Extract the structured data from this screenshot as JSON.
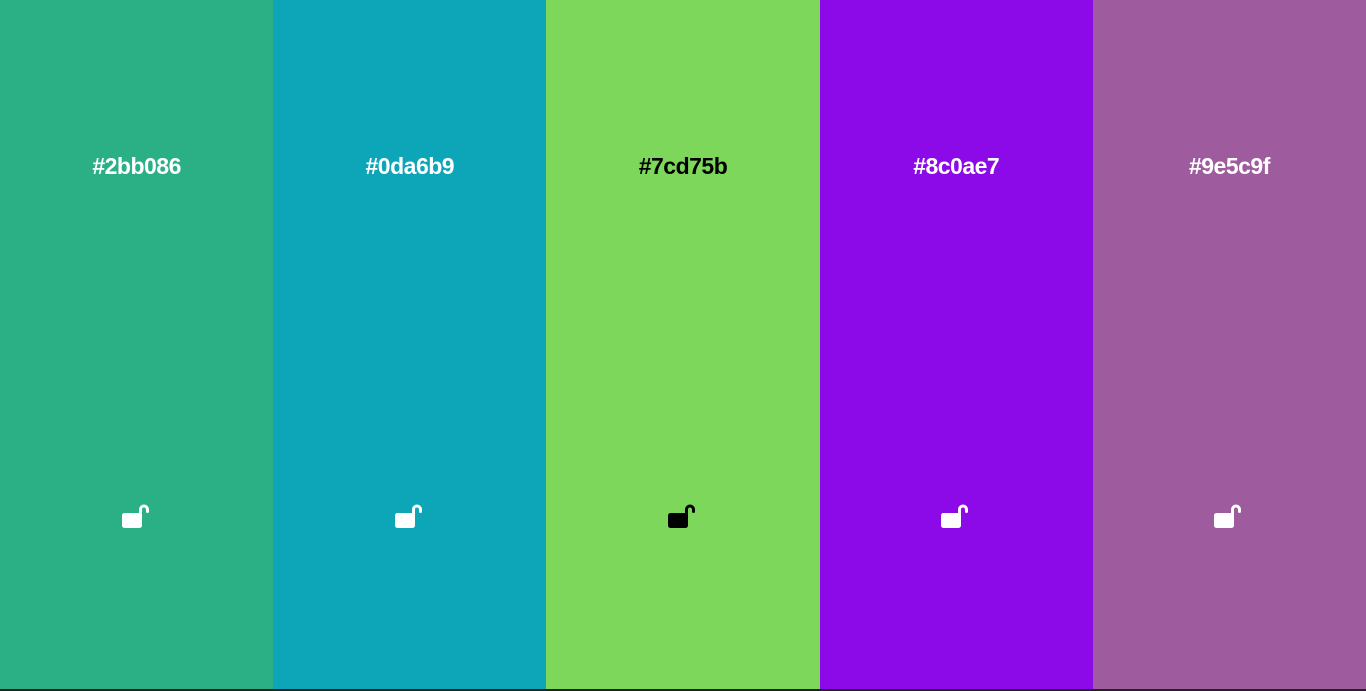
{
  "palette": {
    "colors": [
      {
        "hex": "#2bb086",
        "text_color": "#ffffff",
        "lock_state": "unlocked",
        "icon": "lock-open-icon"
      },
      {
        "hex": "#0da6b9",
        "text_color": "#ffffff",
        "lock_state": "unlocked",
        "icon": "lock-open-icon"
      },
      {
        "hex": "#7cd75b",
        "text_color": "#000000",
        "lock_state": "unlocked",
        "icon": "lock-open-icon"
      },
      {
        "hex": "#8c0ae7",
        "text_color": "#ffffff",
        "lock_state": "unlocked",
        "icon": "lock-open-icon"
      },
      {
        "hex": "#9e5c9f",
        "text_color": "#ffffff",
        "lock_state": "unlocked",
        "icon": "lock-open-icon"
      }
    ]
  }
}
